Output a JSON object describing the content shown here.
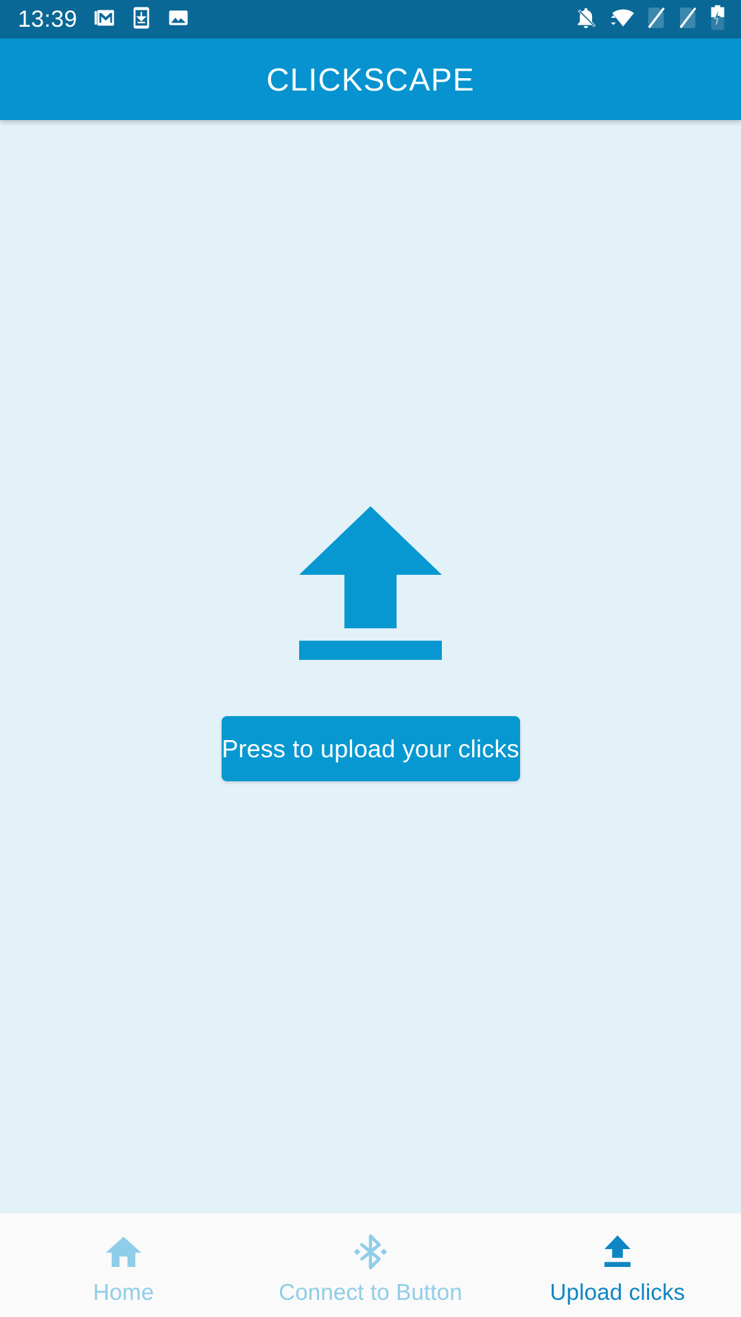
{
  "status_bar": {
    "time": "13:39",
    "left_icons": [
      {
        "name": "gmail-icon",
        "label": "Gmail notification"
      },
      {
        "name": "download-to-phone-icon",
        "label": "Download to device"
      },
      {
        "name": "image-icon",
        "label": "Screenshot saved"
      }
    ],
    "right_icons": [
      {
        "name": "notifications-off-icon",
        "label": "Silent mode"
      },
      {
        "name": "wifi-icon",
        "label": "Wi-Fi connected"
      },
      {
        "name": "sim-card-missing-1-icon",
        "label": "No SIM 1"
      },
      {
        "name": "sim-card-missing-2-icon",
        "label": "No SIM 2"
      },
      {
        "name": "battery-charging-icon",
        "label": "Battery charging"
      }
    ]
  },
  "app_bar": {
    "title": "CLICKSCAPE"
  },
  "main": {
    "upload_icon_name": "upload-arrow-icon",
    "button_label": "Press to upload your clicks"
  },
  "bottom_nav": {
    "items": [
      {
        "label": "Home",
        "icon": "home-icon",
        "active": false
      },
      {
        "label": "Connect to Button",
        "icon": "bluetooth-icon",
        "active": false
      },
      {
        "label": "Upload clicks",
        "icon": "upload-icon",
        "active": true
      }
    ]
  },
  "colors": {
    "status_bar_bg": "#0A6896",
    "app_bar_bg": "#0693D0",
    "content_bg": "#E3F1F8",
    "accent": "#0798D2",
    "nav_bg": "#FAFAFA",
    "nav_inactive": "#8FCDE8",
    "nav_active": "#0E86C4",
    "text_on_accent": "#FFFFFF"
  }
}
